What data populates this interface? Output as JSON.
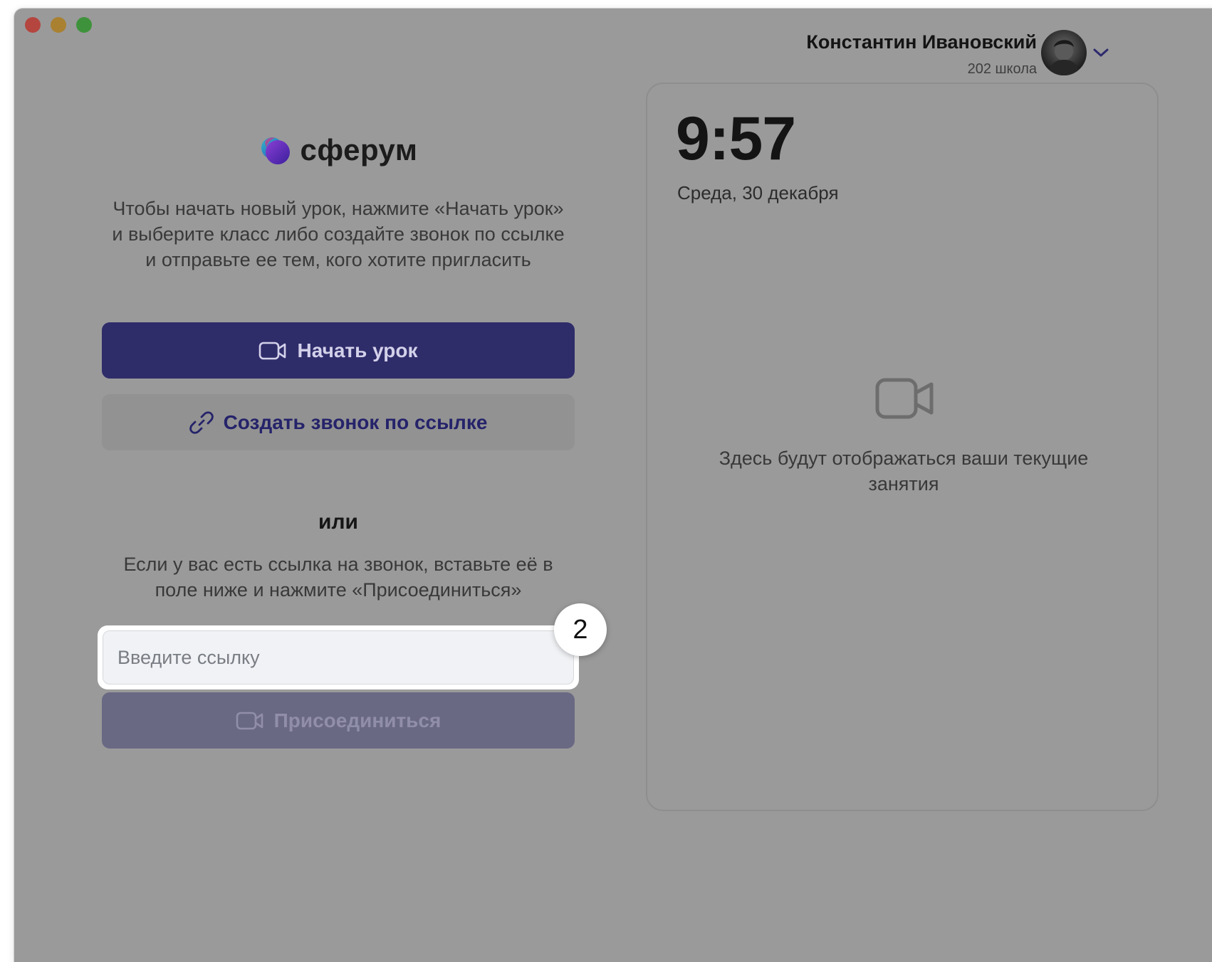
{
  "window": {
    "traffic_lights": [
      "close",
      "minimize",
      "zoom"
    ]
  },
  "user": {
    "name": "Константин Ивановский",
    "school": "202 школа",
    "menu_icon": "chevron-down-icon"
  },
  "brand": {
    "name": "сферум"
  },
  "left": {
    "intro": "Чтобы начать новый урок, нажмите «Начать урок» и выберите класс либо создайте звонок по ссылке и отправьте ее тем, кого хотите пригласить",
    "start_button": "Начать урок",
    "link_button": "Создать звонок по ссылке",
    "or": "или",
    "paste_hint": "Если у вас есть ссылка на звонок, вставьте её в поле ниже и нажмите «Присоединиться»",
    "link_input": {
      "value": "",
      "placeholder": "Введите ссылку"
    },
    "step_badge": "2",
    "join_button": "Присоединиться"
  },
  "right": {
    "time": "9:57",
    "date": "Среда, 30 декабря",
    "empty_message": "Здесь будут отображаться ваши текущие занятия"
  },
  "colors": {
    "primary": "#2f2c6a",
    "link_text": "#25236a",
    "disabled_button": "#6a6984",
    "overlay": "#9a9a9a"
  }
}
